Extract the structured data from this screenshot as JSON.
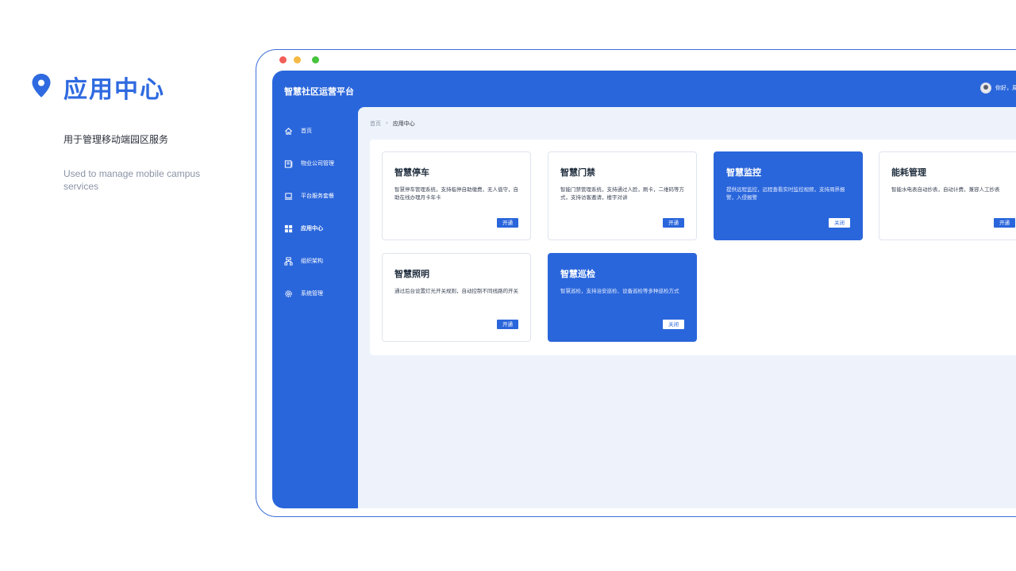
{
  "intro": {
    "title": "应用中心",
    "subtitle_cn": "用于管理移动端园区服务",
    "subtitle_en": "Used to manage mobile campus services",
    "pin_icon": "location-pin-icon"
  },
  "window": {
    "controls": [
      "close",
      "minimize",
      "maximize"
    ]
  },
  "app": {
    "title": "智慧社区运营平台",
    "user_greeting": "你好，周",
    "accent_color": "#2a66db"
  },
  "sidebar": {
    "items": [
      {
        "label": "首页",
        "icon": "home-icon",
        "active": false
      },
      {
        "label": "物业公司管理",
        "icon": "company-icon",
        "active": false
      },
      {
        "label": "平台服务套餐",
        "icon": "laptop-icon",
        "active": false
      },
      {
        "label": "应用中心",
        "icon": "grid-icon",
        "active": true
      },
      {
        "label": "组织架构",
        "icon": "org-chart-icon",
        "active": false
      },
      {
        "label": "系统管理",
        "icon": "gear-icon",
        "active": false
      }
    ]
  },
  "breadcrumb": {
    "home": "首页",
    "separator": "›",
    "current": "应用中心"
  },
  "cards": [
    {
      "title": "智慧停车",
      "desc": "智慧停车管理系统，支持临停自助缴费，无人值守，自助在线办理月卡年卡",
      "button": "开通",
      "enabled": false
    },
    {
      "title": "智慧门禁",
      "desc": "智能门禁管理系统，支持通过人脸，刷卡，二维码等方式，支持访客邀请，楼宇对讲",
      "button": "开通",
      "enabled": false
    },
    {
      "title": "智慧监控",
      "desc": "提供远程监控，远程查看实时监控视频，支持周界报警，入侵报警",
      "button": "关闭",
      "enabled": true
    },
    {
      "title": "能耗管理",
      "desc": "智能水电表自动抄表，自动计费，兼容人工抄表",
      "button": "开通",
      "enabled": false
    },
    {
      "title": "智慧照明",
      "desc": "通过后台设置灯光开关规则，自动控制不同线路的开关",
      "button": "开通",
      "enabled": false
    },
    {
      "title": "智慧巡检",
      "desc": "智慧巡检，支持治安巡检、设备巡检等多种巡检方式",
      "button": "关闭",
      "enabled": true
    }
  ]
}
